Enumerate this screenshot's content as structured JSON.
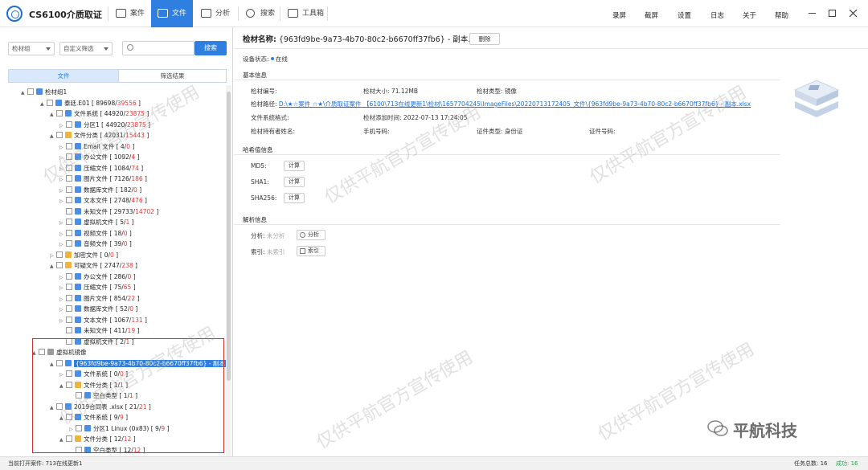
{
  "app": {
    "title": "CS6100介质取证"
  },
  "nav": {
    "tabs": [
      "案件",
      "文件",
      "分析",
      "搜索",
      "工具箱"
    ],
    "active": "文件"
  },
  "menu": [
    "录屏",
    "截屏",
    "设置",
    "日志",
    "关于",
    "帮助"
  ],
  "left": {
    "filter1": "检材组",
    "filter2": "自定义筛选",
    "search_placeholder": "",
    "search_btn": "搜索",
    "tab_files": "文件",
    "tab_results": "筛选结果",
    "tree": [
      {
        "text": "检材组1",
        "count": ""
      },
      {
        "text": "泰廷.E01",
        "count": "[ 89698/",
        "red": "39556",
        "end": " ]"
      },
      {
        "text": "文件系统",
        "count": "[ 44920/",
        "red": "23875",
        "end": " ]"
      },
      {
        "text": "分区1",
        "count": "[ 44920/",
        "red": "23875",
        "end": " ]"
      },
      {
        "text": "文件分类",
        "count": "[ 42031/",
        "red": "15443",
        "end": " ]"
      },
      {
        "text": "Email 文件",
        "count": "[ 4/",
        "red": "0",
        "end": " ]"
      },
      {
        "text": "办公文件",
        "count": "[ 1092/",
        "red": "4",
        "end": " ]"
      },
      {
        "text": "压缩文件",
        "count": "[ 1084/",
        "red": "74",
        "end": " ]"
      },
      {
        "text": "图片文件",
        "count": "[ 7126/",
        "red": "186",
        "end": " ]"
      },
      {
        "text": "数据库文件",
        "count": "[ 182/",
        "red": "0",
        "end": " ]"
      },
      {
        "text": "文本文件",
        "count": "[ 2748/",
        "red": "476",
        "end": " ]"
      },
      {
        "text": "未知文件",
        "count": "[ 29733/",
        "red": "14702",
        "end": " ]"
      },
      {
        "text": "虚拟机文件",
        "count": "[ 5/",
        "red": "1",
        "end": " ]"
      },
      {
        "text": "视频文件",
        "count": "[ 18/",
        "red": "0",
        "end": " ]"
      },
      {
        "text": "音频文件",
        "count": "[ 39/",
        "red": "0",
        "end": " ]"
      },
      {
        "text": "加密文件",
        "count": "[ 0/",
        "red": "0",
        "end": " ]"
      },
      {
        "text": "可疑文件",
        "count": "[ 2747/",
        "red": "238",
        "end": " ]"
      },
      {
        "text": "办公文件",
        "count": "[ 286/",
        "red": "0",
        "end": " ]"
      },
      {
        "text": "压缩文件",
        "count": "[ 75/",
        "red": "65",
        "end": " ]"
      },
      {
        "text": "图片文件",
        "count": "[ 854/",
        "red": "22",
        "end": " ]"
      },
      {
        "text": "数据库文件",
        "count": "[ 52/",
        "red": "0",
        "end": " ]"
      },
      {
        "text": "文本文件",
        "count": "[ 1067/",
        "red": "131",
        "end": " ]"
      },
      {
        "text": "未知文件",
        "count": "[ 411/",
        "red": "19",
        "end": " ]"
      },
      {
        "text": "虚拟机文件",
        "count": "[ 2/",
        "red": "1",
        "end": " ]"
      },
      {
        "text": "虚拟机镜像",
        "count": ""
      },
      {
        "text": "{963fd9be-9a73-4b70-80c2-b6670ff37fb6} - 副本",
        "count": ""
      },
      {
        "text": "文件系统",
        "count": "[ 0/",
        "red": "0",
        "end": " ]"
      },
      {
        "text": "文件分类",
        "count": "[ 1/",
        "red": "1",
        "end": " ]"
      },
      {
        "text": "空白类型",
        "count": "[ 1/",
        "red": "1",
        "end": " ]"
      },
      {
        "text": "2019合同表 .xlsx",
        "count": "[ 21/",
        "red": "21",
        "end": " ]"
      },
      {
        "text": "文件系统",
        "count": "[ 9/",
        "red": "9",
        "end": " ]"
      },
      {
        "text": "分区1 Linux (0x83)",
        "count": "[ 9/",
        "red": "9",
        "end": " ]"
      },
      {
        "text": "文件分类",
        "count": "[ 12/",
        "red": "12",
        "end": " ]"
      },
      {
        "text": "空白类型",
        "count": "[ 12/",
        "red": "12",
        "end": " ]"
      }
    ]
  },
  "detail": {
    "name_label": "检材名称:",
    "name_value": "{963fd9be-9a73-4b70-80c2-b6670ff37fb6} - 副本.xlsx",
    "delete_btn": "删除",
    "status_label": "设备状态:",
    "status_value": "在线",
    "basic_title": "基本信息",
    "id_label": "检材编号:",
    "size_label": "检材大小:",
    "size_value": "71.12MB",
    "type_label": "检材类型:",
    "type_value": "镜像",
    "path_label": "检材路径:",
    "path_value": "D:\\★☆案件 ☆★\\介质取证案件 【6100\\713在线更新1\\检材\\1657704245\\ImageFiles\\20220713172405_文件\\{963fd9be-9a73-4b70-80c2-b6670ff37fb6} - 副本.xlsx",
    "fs_label": "文件系统格式:",
    "added_label": "检材添加时间:",
    "added_value": "2022-07-13 17:24:05",
    "holder_label": "检材持有者姓名:",
    "phone_label": "手机号码:",
    "idtype_label": "证件类型:",
    "idtype_value": "身份证",
    "idno_label": "证件号码:",
    "hash_title": "哈希值信息",
    "md5_label": "MD5:",
    "sha1_label": "SHA1:",
    "sha256_label": "SHA256:",
    "calc_btn": "计算",
    "parse_title": "解析信息",
    "analysis_label": "分析:",
    "analysis_status": "未分析",
    "analysis_btn": "分析",
    "index_label": "索引:",
    "index_status": "未索引",
    "index_btn": "索引"
  },
  "status": {
    "left": "当前打开案件: 713在线更新1",
    "tasks_label": "任务总数: 16",
    "success_label": "成功: 16"
  },
  "watermark": "仅供平航官方宣传使用",
  "brand": {
    "name": "平航科技"
  },
  "colors": {
    "accent": "#2f7fe0",
    "red": "#e53935",
    "highlight_box": "#d32f2f"
  }
}
